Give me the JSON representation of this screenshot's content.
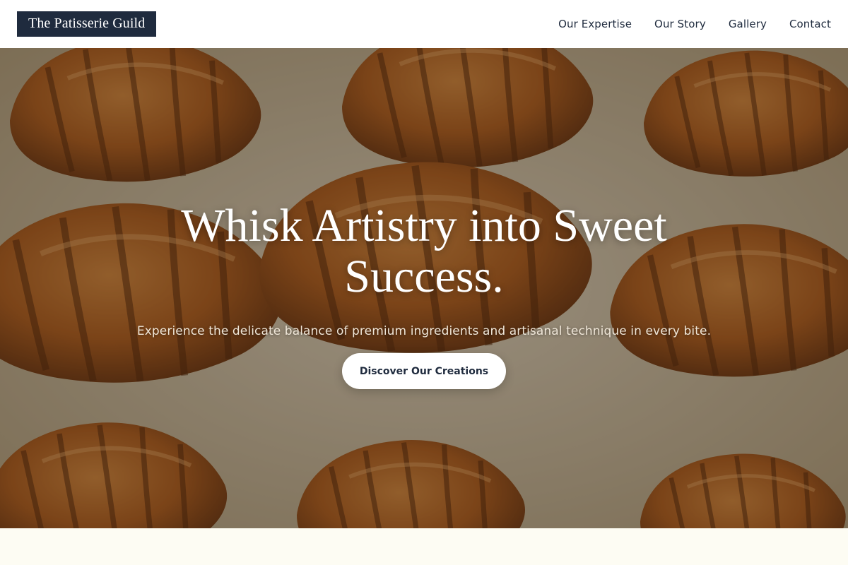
{
  "header": {
    "brand": "The Patisserie Guild",
    "nav": [
      {
        "label": "Our Expertise"
      },
      {
        "label": "Our Story"
      },
      {
        "label": "Gallery"
      },
      {
        "label": "Contact"
      }
    ]
  },
  "hero": {
    "title": "Whisk Artistry into Sweet Success.",
    "subtitle": "Experience the delicate balance of premium ingredients and artisanal technique in every bite.",
    "cta_label": "Discover Our Creations",
    "background_image": "croissants-on-baking-paper"
  },
  "colors": {
    "brand_navy": "#1f2b3e",
    "header_bg": "#ffffff",
    "cta_bg": "#ffffff",
    "page_bg": "#fdfcf3"
  }
}
